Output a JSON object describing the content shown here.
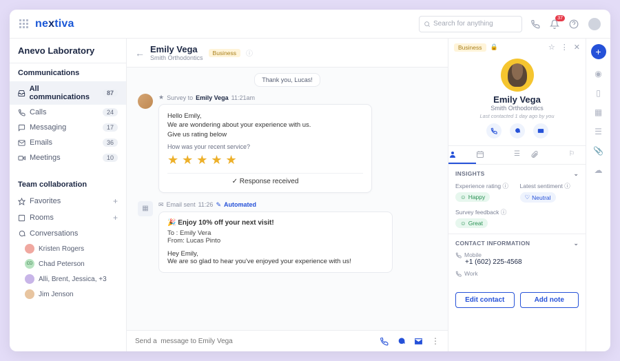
{
  "logo": {
    "prefix": "ne",
    "x": "x",
    "suffix": "tiva"
  },
  "search": {
    "placeholder": "Search for anything"
  },
  "topbar": {
    "notif_count": "37"
  },
  "workspace": "Anevo Laboratory",
  "sidebar": {
    "section1": "Communications",
    "items": [
      {
        "label": "All communications",
        "count": "87"
      },
      {
        "label": "Calls",
        "count": "24"
      },
      {
        "label": "Messaging",
        "count": "17"
      },
      {
        "label": "Emails",
        "count": "36"
      },
      {
        "label": "Meetings",
        "count": "10"
      }
    ],
    "section2": "Team collaboration",
    "team": [
      {
        "label": "Favorites"
      },
      {
        "label": "Rooms"
      },
      {
        "label": "Conversations"
      }
    ],
    "people": [
      {
        "name": "Kristen Rogers"
      },
      {
        "name": "Chad Peterson",
        "initials": "CD"
      },
      {
        "name": "Alli, Brent, Jessica, +3"
      },
      {
        "name": "Jim Jenson"
      }
    ]
  },
  "thread": {
    "name": "Emily Vega",
    "org": "Smith Orthodontics",
    "chip": "Business",
    "prev_msg": "Thank you, Lucas!",
    "survey": {
      "prefix": "Survey to",
      "name": "Emily Vega",
      "time": "11:21am"
    },
    "card1": {
      "greeting": "Hello Emily,",
      "body1": "We are wondering about your experience with us.",
      "body2": "Give us rating below",
      "question": "How was your recent service?",
      "response": "Response received"
    },
    "email": {
      "prefix": "Email sent",
      "time": "11:26",
      "auto": "Automated"
    },
    "card2": {
      "subject": "Enjoy 10% off your next visit!",
      "to_lbl": "To :",
      "to": "Emily Vera",
      "from_lbl": "From:",
      "from": "Lucas Pinto",
      "greeting": "Hey Emily,",
      "body": "We are so glad to hear you've enjoyed your experience with us!"
    },
    "composer_placeholder": "Send a  message to Emily Vega"
  },
  "detail": {
    "chip": "Business",
    "name": "Emily Vega",
    "org": "Smith Orthodontics",
    "meta": "Last contacted 1 day ago by you",
    "insights": {
      "title": "INSIGHTS",
      "exp_label": "Experience rating",
      "exp_val": "Happy",
      "sent_label": "Latest sentiment",
      "sent_val": "Neutral",
      "fb_label": "Survey feedback",
      "fb_val": "Great"
    },
    "contact": {
      "title": "CONTACT INFORMATION",
      "mobile_lbl": "Mobile",
      "mobile": "+1 (602) 225-4568",
      "work_lbl": "Work"
    },
    "edit": "Edit contact",
    "add": "Add note"
  }
}
